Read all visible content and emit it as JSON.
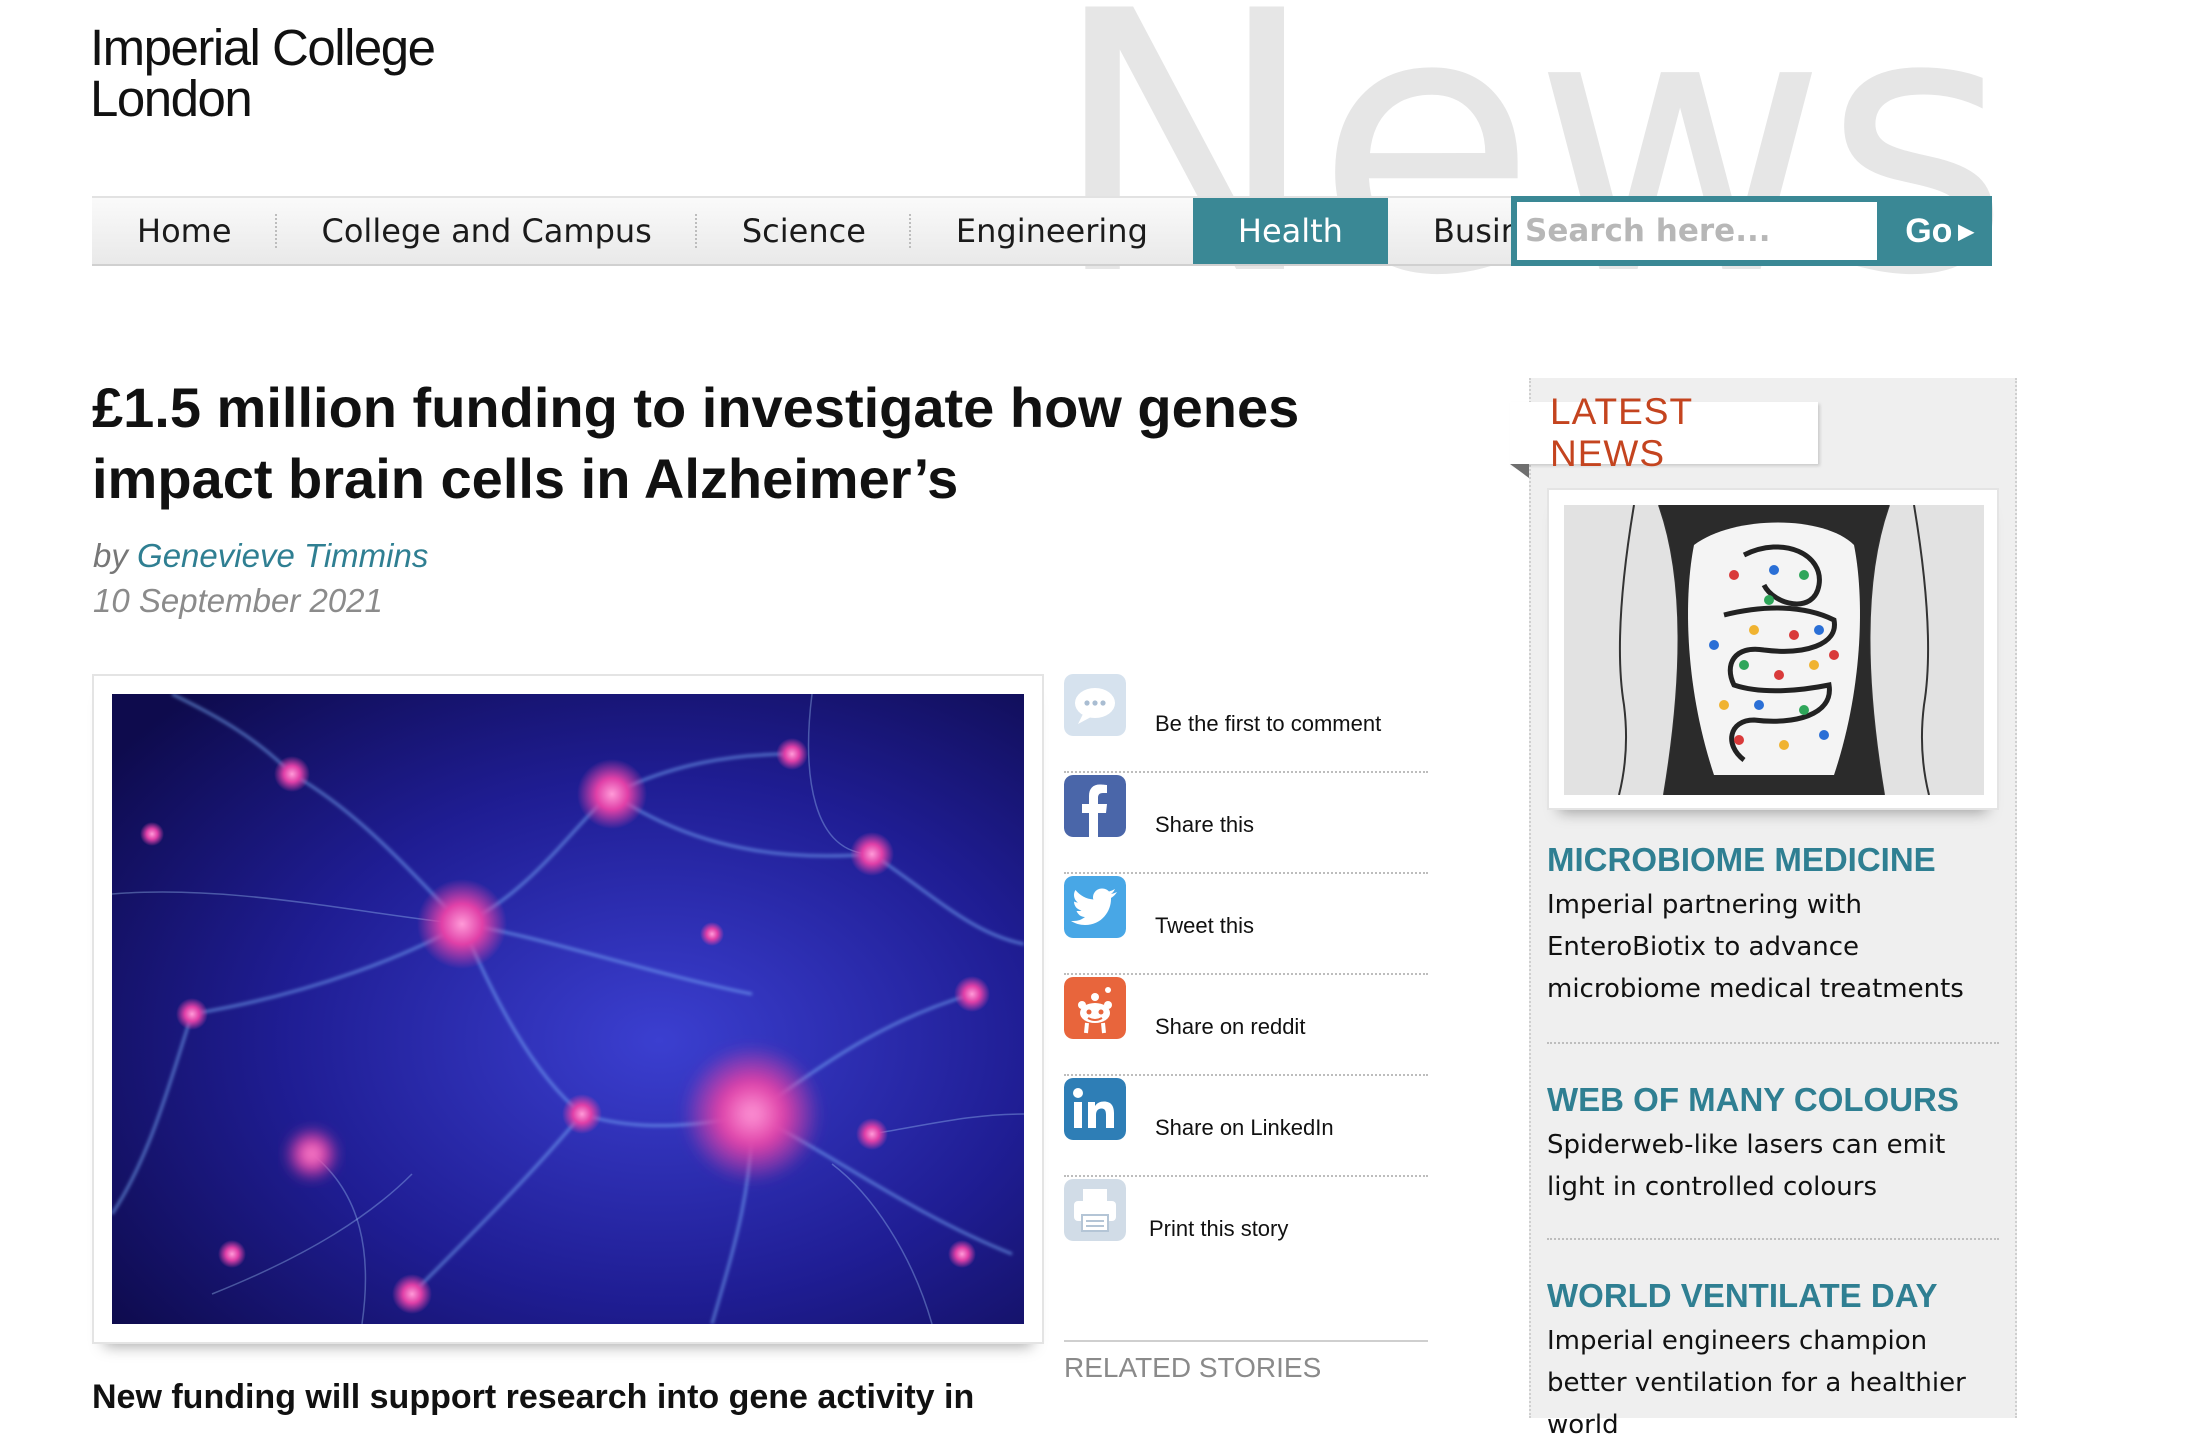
{
  "site": {
    "logo_line1": "Imperial College",
    "logo_line2": "London",
    "section_watermark": "News"
  },
  "nav": {
    "items": [
      {
        "label": "Home"
      },
      {
        "label": "College and Campus"
      },
      {
        "label": "Science"
      },
      {
        "label": "Engineering"
      },
      {
        "label": "Health",
        "active": true
      },
      {
        "label": "Business"
      }
    ],
    "active_color": "#3a8895"
  },
  "search": {
    "placeholder": "Search here...",
    "go_label": "Go"
  },
  "article": {
    "headline": "£1.5 million funding to investigate how genes impact brain cells in Alzheimer’s",
    "by_prefix": "by",
    "author": "Genevieve Timmins",
    "date": "10 September 2021",
    "lede": "New funding will support research into gene activity in"
  },
  "share": {
    "items": [
      {
        "label": "Be the first to comment",
        "icon": "comment-icon"
      },
      {
        "label": "Share this",
        "icon": "facebook-icon"
      },
      {
        "label": "Tweet this",
        "icon": "twitter-icon"
      },
      {
        "label": "Share on reddit",
        "icon": "reddit-icon"
      },
      {
        "label": "Share on LinkedIn",
        "icon": "linkedin-icon"
      },
      {
        "label": "Print this story",
        "icon": "printer-icon"
      }
    ],
    "related_heading": "RELATED STORIES"
  },
  "sidebar": {
    "heading": "LATEST NEWS",
    "accent_color": "#c4441f",
    "items": [
      {
        "title": "MICROBIOME MEDICINE",
        "desc": "Imperial partnering with EnteroBiotix to advance microbiome medical treatments"
      },
      {
        "title": "WEB OF MANY COLOURS",
        "desc": "Spiderweb-like lasers can emit light in controlled colours"
      },
      {
        "title": "WORLD VENTILATE DAY",
        "desc": "Imperial engineers champion better ventilation for a healthier world"
      }
    ]
  }
}
